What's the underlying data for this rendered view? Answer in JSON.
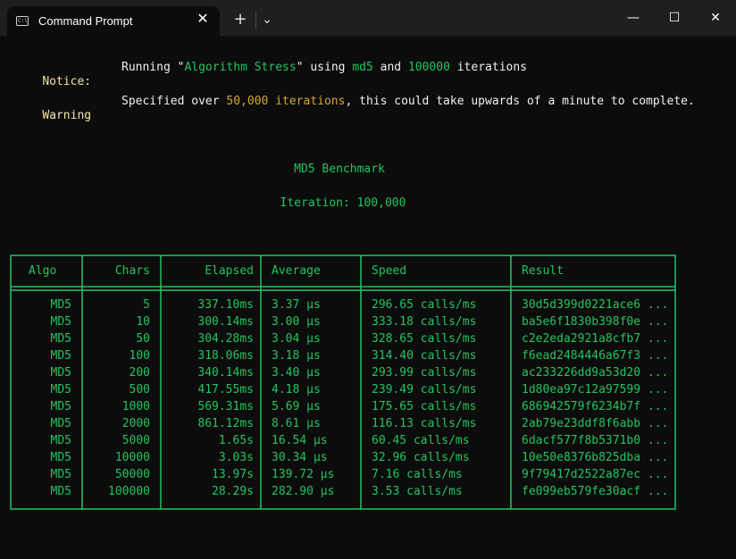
{
  "window": {
    "tab_title": "Command Prompt",
    "tab_icon_text": "C:\\",
    "tab_close": "✕",
    "new_tab": "+",
    "tab_menu": "⌄",
    "minimize": "—",
    "maximize": "☐",
    "close": "✕"
  },
  "notice": {
    "label": "Notice:",
    "prefix": "Running \"",
    "name": "Algorithm Stress",
    "mid1": "\" using ",
    "algo": "md5",
    "mid2": " and ",
    "iterations": "100000",
    "suffix": " iterations"
  },
  "warning": {
    "label": "Warning",
    "prefix": "Specified over ",
    "highlight": "50,000 iterations",
    "suffix": ", this could take upwards of a minute to complete."
  },
  "benchmark": {
    "title": "MD5 Benchmark",
    "iteration_line": "Iteration: 100,000"
  },
  "table": {
    "headers": [
      "Algo",
      "Chars",
      "Elapsed",
      "Average",
      "Speed",
      "Result"
    ],
    "rows": [
      [
        "MD5",
        "5",
        "337.10ms",
        "3.37 µs",
        "296.65 calls/ms",
        "30d5d399d0221ace6 ..."
      ],
      [
        "MD5",
        "10",
        "300.14ms",
        "3.00 µs",
        "333.18 calls/ms",
        "ba5e6f1830b398f0e ..."
      ],
      [
        "MD5",
        "50",
        "304.28ms",
        "3.04 µs",
        "328.65 calls/ms",
        "c2e2eda2921a8cfb7 ..."
      ],
      [
        "MD5",
        "100",
        "318.06ms",
        "3.18 µs",
        "314.40 calls/ms",
        "f6ead2484446a67f3 ..."
      ],
      [
        "MD5",
        "200",
        "340.14ms",
        "3.40 µs",
        "293.99 calls/ms",
        "ac233226dd9a53d20 ..."
      ],
      [
        "MD5",
        "500",
        "417.55ms",
        "4.18 µs",
        "239.49 calls/ms",
        "1d80ea97c12a97599 ..."
      ],
      [
        "MD5",
        "1000",
        "569.31ms",
        "5.69 µs",
        "175.65 calls/ms",
        "686942579f6234b7f ..."
      ],
      [
        "MD5",
        "2000",
        "861.12ms",
        "8.61 µs",
        "116.13 calls/ms",
        "2ab79e23ddf8f6abb ..."
      ],
      [
        "MD5",
        "5000",
        "1.65s",
        "16.54 µs",
        "60.45 calls/ms",
        "6dacf577f8b5371b0 ..."
      ],
      [
        "MD5",
        "10000",
        "3.03s",
        "30.34 µs",
        "32.96 calls/ms",
        "10e50e8376b825dba ..."
      ],
      [
        "MD5",
        "50000",
        "13.97s",
        "139.72 µs",
        "7.16 calls/ms",
        "9f79417d2522a87ec ..."
      ],
      [
        "MD5",
        "100000",
        "28.29s",
        "282.90 µs",
        "3.53 calls/ms",
        "fe099eb579fe30acf ..."
      ]
    ]
  }
}
